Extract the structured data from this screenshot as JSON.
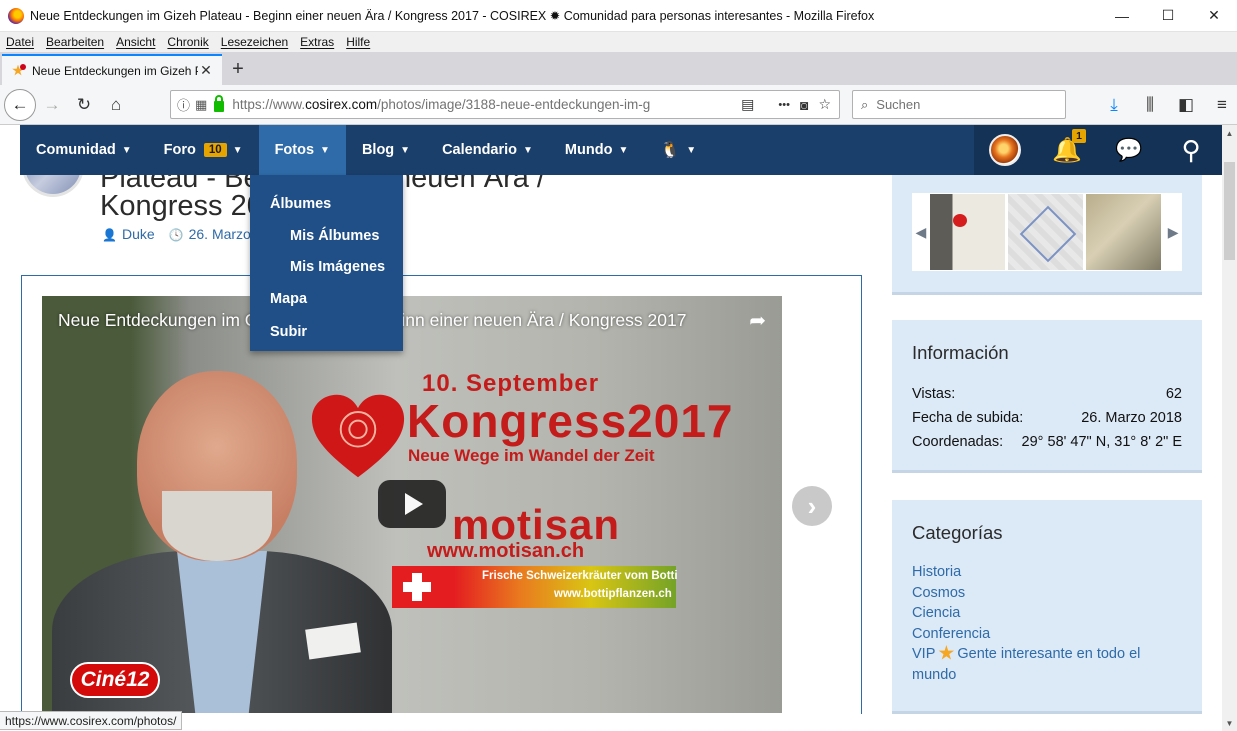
{
  "window": {
    "title": "Neue Entdeckungen im Gizeh Plateau - Beginn einer neuen Ära / Kongress 2017 - COSIREX ✹ Comunidad para personas interesantes - Mozilla Firefox",
    "minimize": "—",
    "maximize": "☐",
    "close": "✕"
  },
  "menubar": [
    "Datei",
    "Bearbeiten",
    "Ansicht",
    "Chronik",
    "Lesezeichen",
    "Extras",
    "Hilfe"
  ],
  "tab": {
    "title": "Neue Entdeckungen im Gizeh P",
    "close": "✕",
    "new_tab": "+"
  },
  "navbar": {
    "back": "←",
    "forward": "→",
    "reload": "↻",
    "home": "⌂",
    "url_base": "https://www.",
    "url_domain": "cosirex.com",
    "url_path": "/photos/image/3188-neue-entdeckungen-im-g",
    "search_placeholder": "Suchen",
    "more": "•••"
  },
  "site_nav": {
    "items": [
      {
        "label": "Comunidad",
        "active": false
      },
      {
        "label": "Foro",
        "badge": "10",
        "active": false
      },
      {
        "label": "Fotos",
        "active": true
      },
      {
        "label": "Blog",
        "active": false
      },
      {
        "label": "Calendario",
        "active": false
      },
      {
        "label": "Mundo",
        "active": false
      }
    ],
    "notification_count": "1"
  },
  "fotos_dropdown": [
    "Álbumes",
    "Mis Álbumes",
    "Mis Imágenes",
    "Mapa",
    "Subir"
  ],
  "header": {
    "title_line1": "Plateau - Beginn einer neuen Ära /",
    "title_line2": "Kongress 2017",
    "author": "Duke",
    "date": "26. Marzo 2018"
  },
  "video": {
    "title": "Neue Entdeckungen im Gizeh Plateau - Beginn einer neuen Ära / Kongress 2017",
    "sept": "10. September",
    "kongress": "Kongress2017",
    "subtitle": "Neue Wege im Wandel der Zeit",
    "motisan": "motisan",
    "motisan_url": "www.motisan.ch",
    "botti_line1": "Frische Schweizerkräuter vom Botti",
    "botti_line2": "www.bottipflanzen.ch",
    "cine": "Ciné12"
  },
  "info": {
    "heading": "Información",
    "rows": [
      {
        "label": "Vistas:",
        "value": "62"
      },
      {
        "label": "Fecha de subida:",
        "value": "26. Marzo 2018"
      },
      {
        "label": "Coordenadas:",
        "value": "29° 58' 47\" N, 31° 8' 2\" E"
      }
    ]
  },
  "categories": {
    "heading": "Categorías",
    "items": [
      "Historia",
      "Cosmos",
      "Ciencia",
      "Conferencia"
    ],
    "vip_prefix": "VIP",
    "vip_suffix": "Gente interesante en todo el mundo"
  },
  "statusbar": {
    "text": "https://www.cosirex.com/photos/"
  }
}
